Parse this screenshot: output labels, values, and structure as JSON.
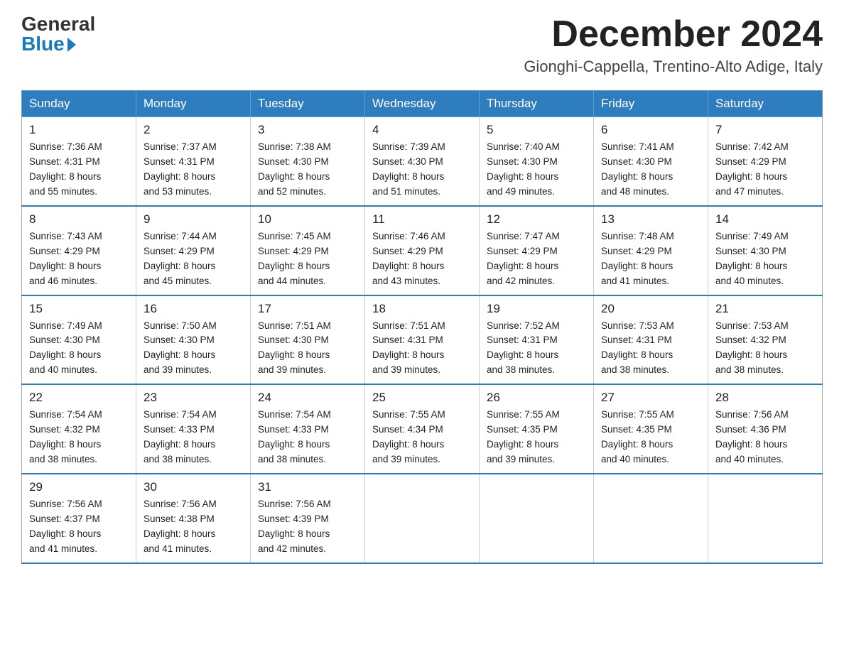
{
  "logo": {
    "general": "General",
    "blue": "Blue"
  },
  "header": {
    "month": "December 2024",
    "location": "Gionghi-Cappella, Trentino-Alto Adige, Italy"
  },
  "weekdays": [
    "Sunday",
    "Monday",
    "Tuesday",
    "Wednesday",
    "Thursday",
    "Friday",
    "Saturday"
  ],
  "weeks": [
    [
      {
        "day": "1",
        "sunrise": "7:36 AM",
        "sunset": "4:31 PM",
        "daylight": "8 hours and 55 minutes."
      },
      {
        "day": "2",
        "sunrise": "7:37 AM",
        "sunset": "4:31 PM",
        "daylight": "8 hours and 53 minutes."
      },
      {
        "day": "3",
        "sunrise": "7:38 AM",
        "sunset": "4:30 PM",
        "daylight": "8 hours and 52 minutes."
      },
      {
        "day": "4",
        "sunrise": "7:39 AM",
        "sunset": "4:30 PM",
        "daylight": "8 hours and 51 minutes."
      },
      {
        "day": "5",
        "sunrise": "7:40 AM",
        "sunset": "4:30 PM",
        "daylight": "8 hours and 49 minutes."
      },
      {
        "day": "6",
        "sunrise": "7:41 AM",
        "sunset": "4:30 PM",
        "daylight": "8 hours and 48 minutes."
      },
      {
        "day": "7",
        "sunrise": "7:42 AM",
        "sunset": "4:29 PM",
        "daylight": "8 hours and 47 minutes."
      }
    ],
    [
      {
        "day": "8",
        "sunrise": "7:43 AM",
        "sunset": "4:29 PM",
        "daylight": "8 hours and 46 minutes."
      },
      {
        "day": "9",
        "sunrise": "7:44 AM",
        "sunset": "4:29 PM",
        "daylight": "8 hours and 45 minutes."
      },
      {
        "day": "10",
        "sunrise": "7:45 AM",
        "sunset": "4:29 PM",
        "daylight": "8 hours and 44 minutes."
      },
      {
        "day": "11",
        "sunrise": "7:46 AM",
        "sunset": "4:29 PM",
        "daylight": "8 hours and 43 minutes."
      },
      {
        "day": "12",
        "sunrise": "7:47 AM",
        "sunset": "4:29 PM",
        "daylight": "8 hours and 42 minutes."
      },
      {
        "day": "13",
        "sunrise": "7:48 AM",
        "sunset": "4:29 PM",
        "daylight": "8 hours and 41 minutes."
      },
      {
        "day": "14",
        "sunrise": "7:49 AM",
        "sunset": "4:30 PM",
        "daylight": "8 hours and 40 minutes."
      }
    ],
    [
      {
        "day": "15",
        "sunrise": "7:49 AM",
        "sunset": "4:30 PM",
        "daylight": "8 hours and 40 minutes."
      },
      {
        "day": "16",
        "sunrise": "7:50 AM",
        "sunset": "4:30 PM",
        "daylight": "8 hours and 39 minutes."
      },
      {
        "day": "17",
        "sunrise": "7:51 AM",
        "sunset": "4:30 PM",
        "daylight": "8 hours and 39 minutes."
      },
      {
        "day": "18",
        "sunrise": "7:51 AM",
        "sunset": "4:31 PM",
        "daylight": "8 hours and 39 minutes."
      },
      {
        "day": "19",
        "sunrise": "7:52 AM",
        "sunset": "4:31 PM",
        "daylight": "8 hours and 38 minutes."
      },
      {
        "day": "20",
        "sunrise": "7:53 AM",
        "sunset": "4:31 PM",
        "daylight": "8 hours and 38 minutes."
      },
      {
        "day": "21",
        "sunrise": "7:53 AM",
        "sunset": "4:32 PM",
        "daylight": "8 hours and 38 minutes."
      }
    ],
    [
      {
        "day": "22",
        "sunrise": "7:54 AM",
        "sunset": "4:32 PM",
        "daylight": "8 hours and 38 minutes."
      },
      {
        "day": "23",
        "sunrise": "7:54 AM",
        "sunset": "4:33 PM",
        "daylight": "8 hours and 38 minutes."
      },
      {
        "day": "24",
        "sunrise": "7:54 AM",
        "sunset": "4:33 PM",
        "daylight": "8 hours and 38 minutes."
      },
      {
        "day": "25",
        "sunrise": "7:55 AM",
        "sunset": "4:34 PM",
        "daylight": "8 hours and 39 minutes."
      },
      {
        "day": "26",
        "sunrise": "7:55 AM",
        "sunset": "4:35 PM",
        "daylight": "8 hours and 39 minutes."
      },
      {
        "day": "27",
        "sunrise": "7:55 AM",
        "sunset": "4:35 PM",
        "daylight": "8 hours and 40 minutes."
      },
      {
        "day": "28",
        "sunrise": "7:56 AM",
        "sunset": "4:36 PM",
        "daylight": "8 hours and 40 minutes."
      }
    ],
    [
      {
        "day": "29",
        "sunrise": "7:56 AM",
        "sunset": "4:37 PM",
        "daylight": "8 hours and 41 minutes."
      },
      {
        "day": "30",
        "sunrise": "7:56 AM",
        "sunset": "4:38 PM",
        "daylight": "8 hours and 41 minutes."
      },
      {
        "day": "31",
        "sunrise": "7:56 AM",
        "sunset": "4:39 PM",
        "daylight": "8 hours and 42 minutes."
      },
      null,
      null,
      null,
      null
    ]
  ],
  "labels": {
    "sunrise": "Sunrise:",
    "sunset": "Sunset:",
    "daylight": "Daylight:"
  }
}
